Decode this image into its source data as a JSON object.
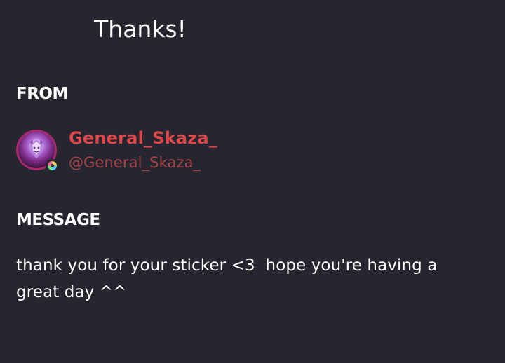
{
  "header": {
    "title": "Thanks!"
  },
  "from_section": {
    "label": "FROM",
    "sender": {
      "display_name": "General_Skaza_",
      "username": "@General_Skaza_",
      "avatar_icon": "avatar-portrait",
      "badge_icon": "nitro-badge-icon"
    }
  },
  "message_section": {
    "label": "MESSAGE",
    "body": "thank you for your sticker <3  hope you're having a great day ^^"
  },
  "colors": {
    "background": "#262631",
    "text": "#ffffff",
    "display_name": "#e0474b",
    "username": "#a44549"
  }
}
